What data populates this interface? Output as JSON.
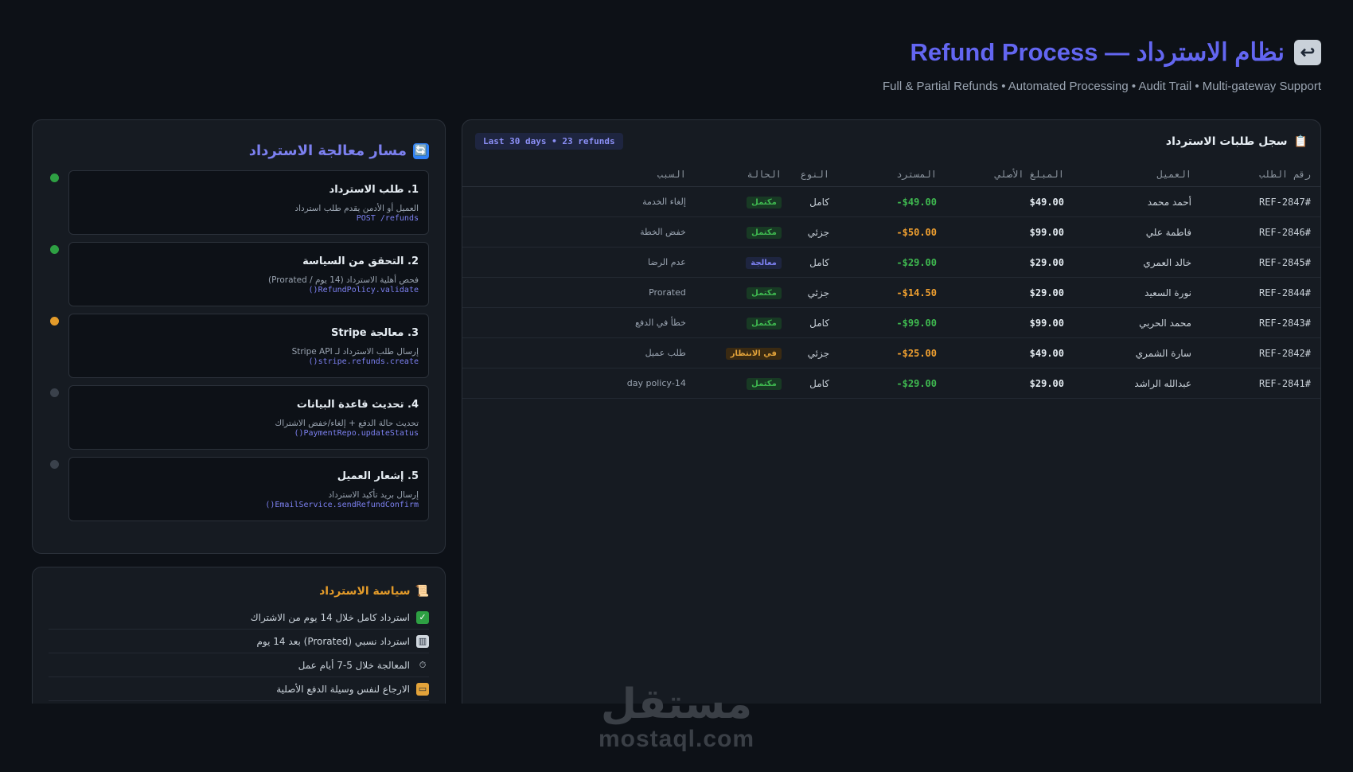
{
  "header": {
    "title": "نظام الاسترداد — Refund Process",
    "title_icon": "return-arrow-icon",
    "subtitle": "Full & Partial Refunds • Automated Processing • Audit Trail • Multi-gateway Support"
  },
  "refunds_table": {
    "title": "سجل طلبات الاسترداد",
    "title_icon": "clipboard-icon",
    "range_badge": "Last 30 days • 23 refunds",
    "columns": [
      "رقم الطلب",
      "العميل",
      "المبلغ الأصلي",
      "المسترد",
      "النوع",
      "الحالة",
      "السبب"
    ],
    "rows": [
      {
        "id": "#REF-2847",
        "customer": "أحمد محمد",
        "original": "$49.00",
        "refunded": "-$49.00",
        "refund_color": "green",
        "type": "كامل",
        "status": "مكتمل",
        "status_kind": "done",
        "reason": "إلغاء الخدمة"
      },
      {
        "id": "#REF-2846",
        "customer": "فاطمة علي",
        "original": "$99.00",
        "refunded": "-$50.00",
        "refund_color": "orange",
        "type": "جزئي",
        "status": "مكتمل",
        "status_kind": "done",
        "reason": "خفض الخطة"
      },
      {
        "id": "#REF-2845",
        "customer": "خالد العمري",
        "original": "$29.00",
        "refunded": "-$29.00",
        "refund_color": "green",
        "type": "كامل",
        "status": "معالجة",
        "status_kind": "proc",
        "reason": "عدم الرضا"
      },
      {
        "id": "#REF-2844",
        "customer": "نورة السعيد",
        "original": "$29.00",
        "refunded": "-$14.50",
        "refund_color": "orange",
        "type": "جزئي",
        "status": "مكتمل",
        "status_kind": "done",
        "reason": "Prorated"
      },
      {
        "id": "#REF-2843",
        "customer": "محمد الحربي",
        "original": "$99.00",
        "refunded": "-$99.00",
        "refund_color": "green",
        "type": "كامل",
        "status": "مكتمل",
        "status_kind": "done",
        "reason": "خطأ في الدفع"
      },
      {
        "id": "#REF-2842",
        "customer": "سارة الشمري",
        "original": "$49.00",
        "refunded": "-$25.00",
        "refund_color": "orange",
        "type": "جزئي",
        "status": "في الانتظار",
        "status_kind": "wait",
        "reason": "طلب عميل"
      },
      {
        "id": "#REF-2841",
        "customer": "عبدالله الراشد",
        "original": "$29.00",
        "refunded": "-$29.00",
        "refund_color": "green",
        "type": "كامل",
        "status": "مكتمل",
        "status_kind": "done",
        "reason": "14-day policy"
      }
    ]
  },
  "flow": {
    "title": "مسار معالجة الاسترداد",
    "title_icon": "cycle-arrows-icon",
    "steps": [
      {
        "title": "1. طلب الاسترداد",
        "desc": "العميل أو الأدمن يقدم طلب استرداد",
        "code": "POST /refunds",
        "state": "green"
      },
      {
        "title": "2. التحقق من السياسة",
        "desc": "فحص أهلية الاسترداد (14 يوم / Prorated)",
        "code": "RefundPolicy.validate()",
        "state": "green"
      },
      {
        "title": "3. معالجة Stripe",
        "desc": "إرسال طلب الاسترداد لـ Stripe API",
        "code": "stripe.refunds.create()",
        "state": "orange"
      },
      {
        "title": "4. تحديث قاعدة البيانات",
        "desc": "تحديث حالة الدفع + إلغاء/خفض الاشتراك",
        "code": "PaymentRepo.updateStatus()",
        "state": "grey"
      },
      {
        "title": "5. إشعار العميل",
        "desc": "إرسال بريد تأكيد الاسترداد",
        "code": "EmailService.sendRefundConfirm()",
        "state": "grey"
      }
    ]
  },
  "policy": {
    "title": "سياسة الاسترداد",
    "title_icon": "scroll-icon",
    "items": [
      {
        "icon": "check-icon",
        "text": "استرداد كامل خلال 14 يوم من الاشتراك"
      },
      {
        "icon": "bar-chart-icon",
        "text": "استرداد نسبي (Prorated) بعد 14 يوم"
      },
      {
        "icon": "stopwatch-icon",
        "text": "المعالجة خلال 5-7 أيام عمل"
      },
      {
        "icon": "credit-card-icon",
        "text": "الارجاع لنفس وسيلة الدفع الأصلية"
      }
    ]
  },
  "watermark": {
    "arabic": "مستقل",
    "latin": "mostaql.com"
  },
  "colors": {
    "accent": "#6366f1",
    "success": "#3fb950",
    "warning": "#e39b2a",
    "background": "#0d1117",
    "panel": "#161b22"
  }
}
